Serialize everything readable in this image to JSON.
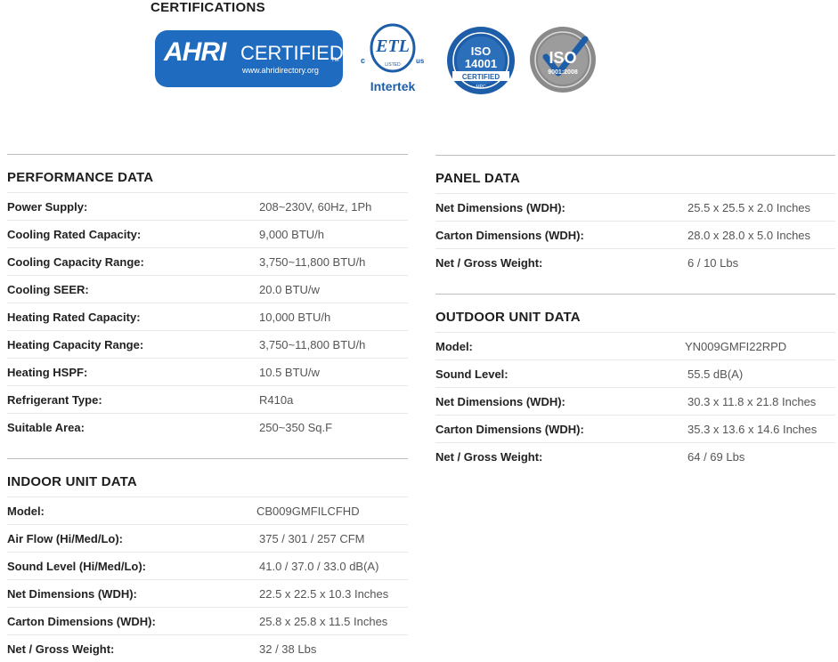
{
  "certifications": {
    "title": "CERTIFICATIONS",
    "ahri": {
      "mark": "AHRI",
      "word": "CERTIFIED",
      "tm": "TM",
      "url": "www.ahridirectory.org"
    },
    "etl": {
      "c": "c",
      "mark": "ETL",
      "listed": "LISTED",
      "us": "us",
      "brand": "Intertek"
    },
    "iso14001": {
      "iso": "ISO",
      "num": "14001",
      "band": "CERTIFIED",
      "mpc": "MPC"
    },
    "iso9001": {
      "iso": "ISO",
      "num": "9001:2008"
    }
  },
  "performance": {
    "title": "PERFORMANCE DATA",
    "rows": [
      {
        "label": "Power Supply:",
        "value": "208~230V, 60Hz, 1Ph"
      },
      {
        "label": "Cooling Rated Capacity:",
        "value": "9,000 BTU/h"
      },
      {
        "label": "Cooling Capacity Range:",
        "value": "3,750~11,800 BTU/h"
      },
      {
        "label": "Cooling SEER:",
        "value": "20.0 BTU/w"
      },
      {
        "label": "Heating Rated Capacity:",
        "value": "10,000 BTU/h"
      },
      {
        "label": "Heating Capacity Range:",
        "value": "3,750~11,800 BTU/h"
      },
      {
        "label": "Heating HSPF:",
        "value": "10.5 BTU/w"
      },
      {
        "label": "Refrigerant Type:",
        "value": "R410a"
      },
      {
        "label": "Suitable Area:",
        "value": "250~350 Sq.F"
      }
    ]
  },
  "indoor": {
    "title": "INDOOR UNIT DATA",
    "rows": [
      {
        "label": "Model:",
        "value": "CB009GMFILCFHD"
      },
      {
        "label": "Air Flow (Hi/Med/Lo):",
        "value": "375 / 301 / 257 CFM"
      },
      {
        "label": "Sound Level (Hi/Med/Lo):",
        "value": "41.0 / 37.0 / 33.0 dB(A)"
      },
      {
        "label": "Net Dimensions (WDH):",
        "value": "22.5 x 22.5 x 10.3 Inches"
      },
      {
        "label": "Carton Dimensions (WDH):",
        "value": "25.8 x 25.8 x 11.5 Inches"
      },
      {
        "label": "Net / Gross Weight:",
        "value": "32 / 38 Lbs"
      }
    ]
  },
  "panel": {
    "title": "PANEL DATA",
    "rows": [
      {
        "label": "Net Dimensions (WDH):",
        "value": "25.5 x 25.5 x 2.0 Inches"
      },
      {
        "label": "Carton Dimensions (WDH):",
        "value": "28.0 x 28.0 x 5.0 Inches"
      },
      {
        "label": "Net / Gross Weight:",
        "value": "6 / 10 Lbs"
      }
    ]
  },
  "outdoor": {
    "title": "OUTDOOR UNIT DATA",
    "rows": [
      {
        "label": "Model:",
        "value": "YN009GMFI22RPD"
      },
      {
        "label": "Sound Level:",
        "value": "55.5 dB(A)"
      },
      {
        "label": "Net Dimensions (WDH):",
        "value": "30.3 x 11.8 x 21.8 Inches"
      },
      {
        "label": "Carton Dimensions (WDH):",
        "value": "35.3 x 13.6 x 14.6 Inches"
      },
      {
        "label": "Net / Gross Weight:",
        "value": "64 / 69 Lbs"
      }
    ]
  },
  "colors": {
    "ahri_blue": "#1f6bbf",
    "iso14_blue": "#1e5ea8",
    "iso9_gray": "#8a8a8a",
    "heading": "#1d1d1d",
    "value_text": "#555555"
  }
}
